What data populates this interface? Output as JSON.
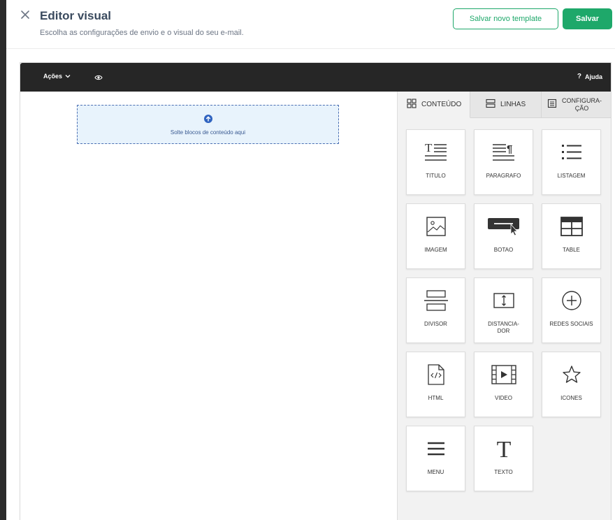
{
  "header": {
    "title": "Editor visual",
    "subtitle": "Escolha as configurações de envio e o visual do seu e-mail.",
    "save_template_label": "Salvar novo template",
    "save_label": "Salvar"
  },
  "toolbar": {
    "actions_label": "Ações",
    "help_label": "Ajuda"
  },
  "canvas": {
    "dropzone_text": "Solte blocos de conteúdo aqui"
  },
  "tabs": [
    {
      "label": "CONTEÚDO",
      "icon": "grid-icon",
      "active": true
    },
    {
      "label": "LINHAS",
      "icon": "rows-icon",
      "active": false
    },
    {
      "label_line1": "CONFIGURA-",
      "label_line2": "ÇÃO",
      "icon": "settings-doc-icon",
      "active": false
    }
  ],
  "blocks": [
    {
      "label": "TITULO",
      "icon": "title-icon"
    },
    {
      "label": "PARAGRAFO",
      "icon": "paragraph-icon"
    },
    {
      "label": "LISTAGEM",
      "icon": "list-icon"
    },
    {
      "label": "IMAGEM",
      "icon": "image-icon"
    },
    {
      "label": "BOTAO",
      "icon": "button-icon"
    },
    {
      "label": "TABLE",
      "icon": "table-icon"
    },
    {
      "label": "DIVISOR",
      "icon": "divider-icon"
    },
    {
      "label_line1": "DISTANCIA-",
      "label_line2": "DOR",
      "icon": "spacer-icon"
    },
    {
      "label": "REDES SOCIAIS",
      "icon": "social-icon"
    },
    {
      "label": "HTML",
      "icon": "html-icon"
    },
    {
      "label": "VIDEO",
      "icon": "video-icon"
    },
    {
      "label": "ICONES",
      "icon": "star-icon"
    },
    {
      "label": "MENU",
      "icon": "menu-icon"
    },
    {
      "label": "TEXTO",
      "icon": "text-icon"
    }
  ],
  "colors": {
    "brand_green": "#1ea86a",
    "toolbar_dark": "#262626",
    "dropzone_bg": "#e8f3fc",
    "dropzone_border": "#4a6fb3"
  }
}
